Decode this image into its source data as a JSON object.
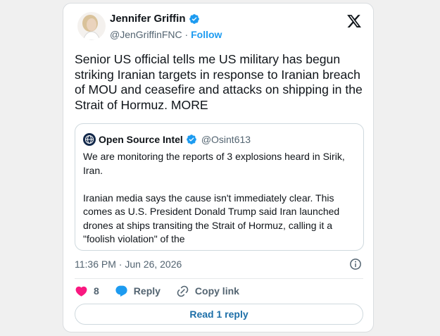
{
  "tweet": {
    "author_name": "Jennifer Griffin",
    "author_handle": "@JenGriffinFNC",
    "separator": "·",
    "follow_label": "Follow",
    "text": "Senior US official tells me US military has begun striking Iranian targets in response to Iranian breach of MOU and ceasefire and attacks on shipping in the Strait of Hormuz. MORE",
    "timestamp": "11:36 PM · Jun 26, 2026",
    "likes": "8",
    "reply_label": "Reply",
    "copy_link_label": "Copy link",
    "read_replies_label": "Read 1 reply"
  },
  "quote": {
    "author_name": "Open Source Intel",
    "author_handle": "@Osint613",
    "text": "We are monitoring the reports of 3 explosions heard in Sirik, Iran.\n\nIranian media says the cause isn't immediately clear. This comes as U.S. President Donald Trump said Iran launched drones at ships transiting the Strait of Hormuz, calling it a \"foolish violation\" of the"
  },
  "icons": {
    "verified": "verified-badge-icon",
    "x_logo": "x-logo-icon",
    "info": "info-icon",
    "like": "heart-icon",
    "reply": "speech-bubble-icon",
    "copy_link": "link-icon"
  },
  "colors": {
    "accent": "#1d9bf0",
    "like": "#f91880",
    "text": "#0f1419",
    "muted": "#536471",
    "border": "#cfd9de"
  }
}
